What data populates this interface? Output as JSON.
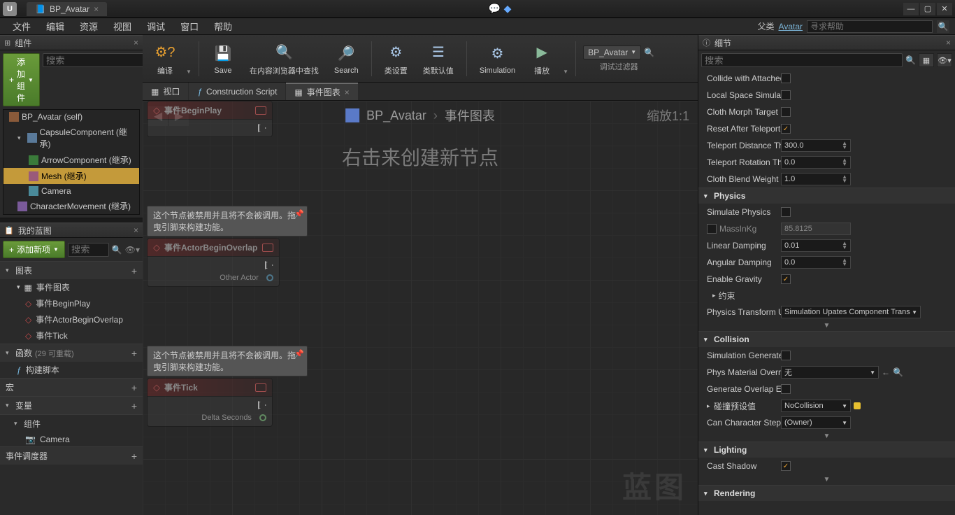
{
  "titlebar": {
    "tab_title": "BP_Avatar"
  },
  "menubar": {
    "items": [
      "文件",
      "编辑",
      "资源",
      "视图",
      "调试",
      "窗口",
      "帮助"
    ],
    "parent_label": "父类",
    "parent_link": "Avatar",
    "help_placeholder": "寻求帮助"
  },
  "components_panel": {
    "title": "组件",
    "add_btn": "添加组件",
    "search_placeholder": "搜索",
    "items": [
      {
        "label": "BP_Avatar (self)"
      },
      {
        "label": "CapsuleComponent (继承)"
      },
      {
        "label": "ArrowComponent (继承)"
      },
      {
        "label": "Mesh (继承)"
      },
      {
        "label": "Camera"
      },
      {
        "label": "CharacterMovement (继承)"
      }
    ]
  },
  "myblueprint": {
    "title": "我的蓝图",
    "add_btn": "添加新项",
    "search_placeholder": "搜索",
    "sec_graphs": "图表",
    "graph_event": "事件图表",
    "events": [
      "事件BeginPlay",
      "事件ActorBeginOverlap",
      "事件Tick"
    ],
    "sec_functions": "函数",
    "func_note": "(29 可重载)",
    "func_construct": "构建脚本",
    "sec_macros": "宏",
    "sec_variables": "变量",
    "sec_components": "组件",
    "var_camera": "Camera",
    "sec_dispatch": "事件调度器"
  },
  "toolbar": {
    "compile": "编译",
    "save": "Save",
    "browse": "在内容浏览器中查找",
    "search": "Search",
    "class_settings": "类设置",
    "class_defaults": "类默认值",
    "simulation": "Simulation",
    "play": "播放",
    "dropdown": "BP_Avatar",
    "debug_filter": "调试过滤器"
  },
  "editor_tabs": {
    "viewport": "视口",
    "construction": "Construction Script",
    "eventgraph": "事件图表"
  },
  "graph": {
    "bc_root": "BP_Avatar",
    "bc_leaf": "事件图表",
    "zoom": "缩放1:1",
    "hint": "右击来创建新节点",
    "watermark": "蓝图",
    "note1": "这个节点被禁用并且将不会被调用。拖曳引脚来构建功能。",
    "note2": "这个节点被禁用并且将不会被调用。拖曳引脚来构建功能。",
    "node_begin": "事件BeginPlay",
    "node_overlap": "事件ActorBeginOverlap",
    "overlap_pin": "Other Actor",
    "node_tick": "事件Tick",
    "tick_pin": "Delta Seconds"
  },
  "details": {
    "title": "细节",
    "search_placeholder": "搜索",
    "rows": {
      "collide_attached": "Collide with Attached",
      "local_space": "Local Space Simulat",
      "cloth_morph": "Cloth Morph Target",
      "reset_teleport": "Reset After Teleport",
      "teleport_dist": "Teleport Distance Th",
      "teleport_dist_v": "300.0",
      "teleport_rot": "Teleport Rotation Th",
      "teleport_rot_v": "0.0",
      "cloth_blend": "Cloth Blend Weight",
      "cloth_blend_v": "1.0"
    },
    "cat_physics": "Physics",
    "physics": {
      "simulate": "Simulate Physics",
      "mass": "MassInKg",
      "mass_v": "85.8125",
      "lin_damp": "Linear Damping",
      "lin_damp_v": "0.01",
      "ang_damp": "Angular Damping",
      "ang_damp_v": "0.0",
      "gravity": "Enable Gravity",
      "constraints": "约束",
      "transform": "Physics Transform U",
      "transform_v": "Simulation Upates Component Trans"
    },
    "cat_collision": "Collision",
    "collision": {
      "sim_gen": "Simulation Generate",
      "phys_mat": "Phys Material Overri",
      "phys_mat_v": "无",
      "gen_overlap": "Generate Overlap Ev",
      "preset": "碰撞预设值",
      "preset_v": "NoCollision",
      "char_step": "Can Character Step U",
      "char_step_v": "(Owner)"
    },
    "cat_lighting": "Lighting",
    "lighting": {
      "cast_shadow": "Cast Shadow"
    },
    "cat_rendering": "Rendering"
  }
}
